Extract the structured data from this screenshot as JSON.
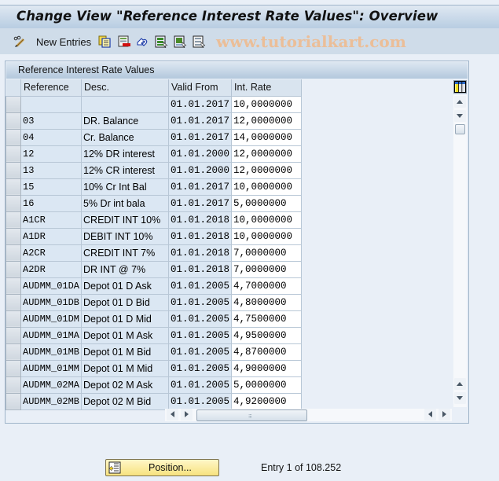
{
  "window": {
    "title": "Change View \"Reference Interest Rate Values\": Overview"
  },
  "toolbar": {
    "new_entries_label": "New Entries",
    "icons": [
      "edit-display-toggle-icon",
      "copy-as-icon",
      "delete-icon",
      "undo-change-icon",
      "select-all-icon",
      "select-block-icon",
      "deselect-all-icon"
    ]
  },
  "watermark": "www.tutorialkart.com",
  "panel": {
    "title": "Reference Interest Rate Values"
  },
  "table": {
    "columns": [
      "Reference",
      "Desc.",
      "Valid From",
      "Int. Rate"
    ],
    "rows": [
      {
        "reference": "",
        "desc": "",
        "valid_from": "01.01.2017",
        "int_rate": "10,0000000"
      },
      {
        "reference": "03",
        "desc": "DR. Balance",
        "valid_from": "01.01.2017",
        "int_rate": "12,0000000"
      },
      {
        "reference": "04",
        "desc": "Cr. Balance",
        "valid_from": "01.01.2017",
        "int_rate": "14,0000000"
      },
      {
        "reference": "12",
        "desc": "12% DR interest",
        "valid_from": "01.01.2000",
        "int_rate": "12,0000000"
      },
      {
        "reference": "13",
        "desc": "12% CR interest",
        "valid_from": "01.01.2000",
        "int_rate": "12,0000000"
      },
      {
        "reference": "15",
        "desc": "10% Cr Int Bal",
        "valid_from": "01.01.2017",
        "int_rate": "10,0000000"
      },
      {
        "reference": "16",
        "desc": "5% Dr int bala",
        "valid_from": "01.01.2017",
        "int_rate": "5,0000000"
      },
      {
        "reference": "A1CR",
        "desc": "CREDIT INT 10%",
        "valid_from": "01.01.2018",
        "int_rate": "10,0000000"
      },
      {
        "reference": "A1DR",
        "desc": "DEBIT INT 10%",
        "valid_from": "01.01.2018",
        "int_rate": "10,0000000"
      },
      {
        "reference": "A2CR",
        "desc": "CREDIT INT 7%",
        "valid_from": "01.01.2018",
        "int_rate": "7,0000000"
      },
      {
        "reference": "A2DR",
        "desc": "DR INT @ 7%",
        "valid_from": "01.01.2018",
        "int_rate": "7,0000000"
      },
      {
        "reference": "AUDMM_01DA",
        "desc": "Depot 01 D Ask",
        "valid_from": "01.01.2005",
        "int_rate": "4,7000000"
      },
      {
        "reference": "AUDMM_01DB",
        "desc": "Depot 01 D Bid",
        "valid_from": "01.01.2005",
        "int_rate": "4,8000000"
      },
      {
        "reference": "AUDMM_01DM",
        "desc": "Depot 01 D Mid",
        "valid_from": "01.01.2005",
        "int_rate": "4,7500000"
      },
      {
        "reference": "AUDMM_01MA",
        "desc": "Depot 01 M Ask",
        "valid_from": "01.01.2005",
        "int_rate": "4,9500000"
      },
      {
        "reference": "AUDMM_01MB",
        "desc": "Depot 01 M Bid",
        "valid_from": "01.01.2005",
        "int_rate": "4,8700000"
      },
      {
        "reference": "AUDMM_01MM",
        "desc": "Depot 01 M Mid",
        "valid_from": "01.01.2005",
        "int_rate": "4,9000000"
      },
      {
        "reference": "AUDMM_02MA",
        "desc": "Depot 02 M Ask",
        "valid_from": "01.01.2005",
        "int_rate": "5,0000000"
      },
      {
        "reference": "AUDMM_02MB",
        "desc": "Depot 02 M Bid",
        "valid_from": "01.01.2005",
        "int_rate": "4,9200000"
      }
    ]
  },
  "footer": {
    "position_button_label": "Position...",
    "entry_info": "Entry 1 of 108.252"
  },
  "colors": {
    "title_gradient_top": "#dfe8f2",
    "title_gradient_bottom": "#b8cde2",
    "toolbar_bg": "#cfdce9",
    "readonly_cell_bg": "#dbe7f3",
    "editable_cell_bg": "#ffffff",
    "position_button_bg": "#f7e27e",
    "watermark": "#f0b98a"
  }
}
